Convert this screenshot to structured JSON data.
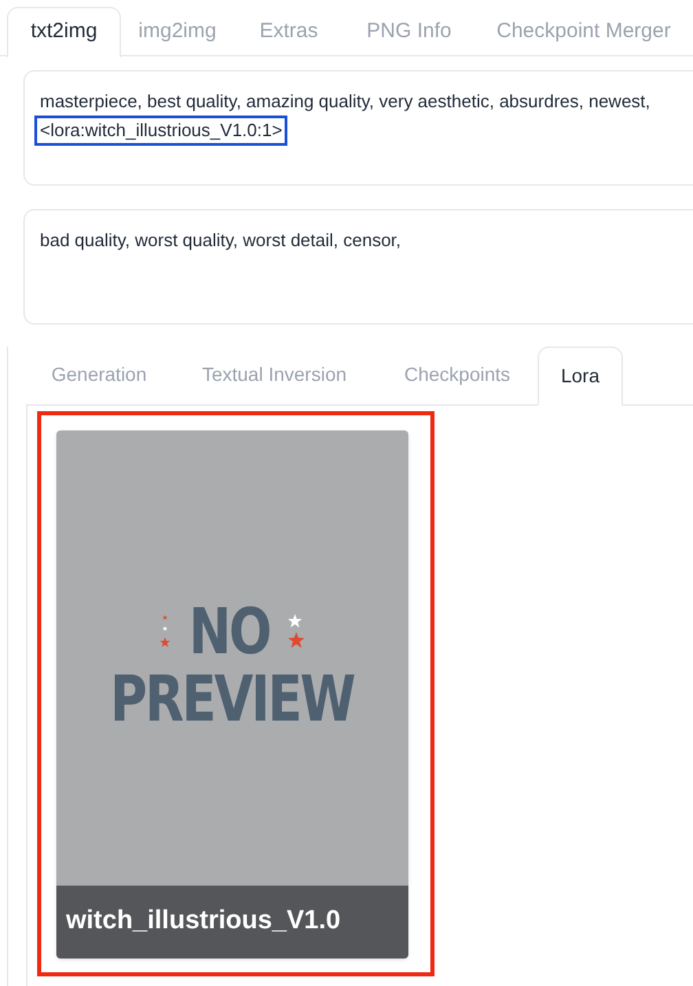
{
  "tabs": [
    {
      "label": "txt2img",
      "selected": true
    },
    {
      "label": "img2img",
      "selected": false
    },
    {
      "label": "Extras",
      "selected": false
    },
    {
      "label": "PNG Info",
      "selected": false
    },
    {
      "label": "Checkpoint Merger",
      "selected": false
    }
  ],
  "prompt": {
    "text": "masterpiece, best quality, amazing quality, very aesthetic, absurdres, newest,",
    "highlighted_text": "<lora:witch_illustrious_V1.0:1>"
  },
  "negative_prompt": {
    "text": "bad quality, worst quality, worst detail, censor,"
  },
  "network_tabs": [
    {
      "label": "Generation",
      "selected": false
    },
    {
      "label": "Textual Inversion",
      "selected": false
    },
    {
      "label": "Checkpoints",
      "selected": false
    },
    {
      "label": "Lora",
      "selected": true
    }
  ],
  "cards": [
    {
      "name": "witch_illustrious_V1.0",
      "preview": {
        "line_1": "NO",
        "line_2": "PREVIEW"
      },
      "highlighted": true
    }
  ]
}
